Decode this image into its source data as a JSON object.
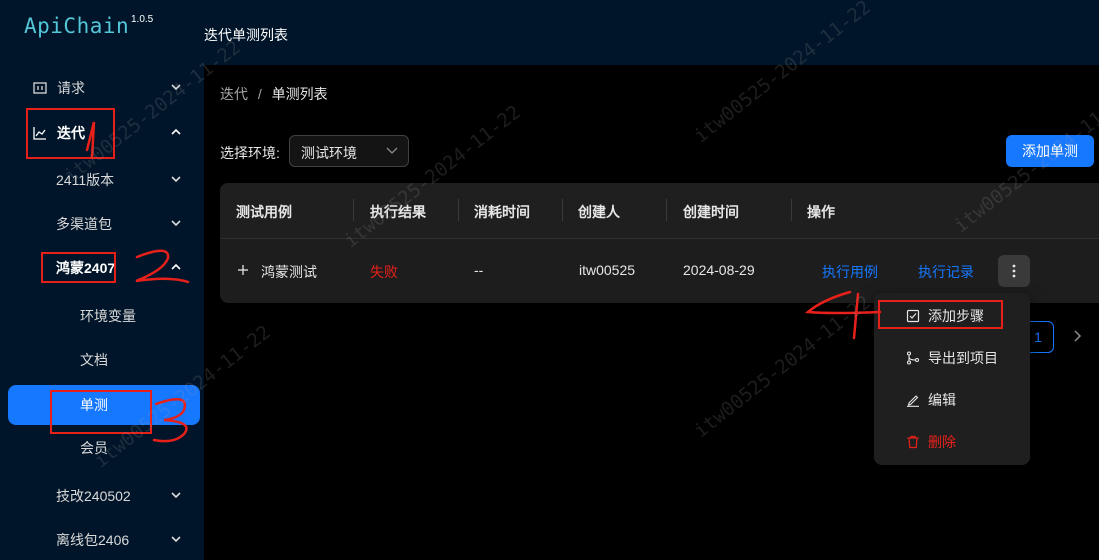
{
  "app": {
    "name": "ApiChain",
    "version": "1.0.5"
  },
  "header": {
    "title": "迭代单测列表"
  },
  "sidebar": {
    "items": [
      {
        "label": "请求",
        "icon": "request-icon",
        "expanded": false
      },
      {
        "label": "迭代",
        "icon": "chart-line-icon",
        "expanded": true
      },
      {
        "label": "2411版本",
        "expanded": false
      },
      {
        "label": "多渠道包",
        "expanded": false
      },
      {
        "label": "鸿蒙2407",
        "expanded": true
      },
      {
        "label": "环境变量"
      },
      {
        "label": "文档"
      },
      {
        "label": "单测",
        "selected": true
      },
      {
        "label": "会员"
      },
      {
        "label": "技改240502",
        "expanded": false
      },
      {
        "label": "离线包2406",
        "expanded": false
      }
    ]
  },
  "breadcrumb": {
    "parent": "迭代",
    "separator": "/",
    "current": "单测列表"
  },
  "env": {
    "label": "选择环境:",
    "selected": "测试环境"
  },
  "add_button": "添加单测",
  "table": {
    "columns": [
      "测试用例",
      "执行结果",
      "消耗时间",
      "创建人",
      "创建时间",
      "操作"
    ],
    "rows": [
      {
        "name": "鸿蒙测试",
        "result": "失败",
        "duration": "--",
        "creator": "itw00525",
        "created": "2024-08-29",
        "action_run": "执行用例",
        "action_history": "执行记录"
      }
    ]
  },
  "dropdown": {
    "items": [
      {
        "label": "添加步骤",
        "icon": "checkbox-icon"
      },
      {
        "label": "导出到项目",
        "icon": "branch-icon"
      },
      {
        "label": "编辑",
        "icon": "edit-icon"
      },
      {
        "label": "删除",
        "icon": "trash-icon",
        "danger": true
      }
    ]
  },
  "pagination": {
    "current": "1"
  },
  "annotations": [
    "1",
    "2",
    "3",
    "4"
  ],
  "watermark": "itw00525-2024-11-22",
  "colors": {
    "accent": "#1677ff",
    "danger": "#e8201a",
    "sidebar_bg": "#001529",
    "logo": "#53c6d8"
  }
}
